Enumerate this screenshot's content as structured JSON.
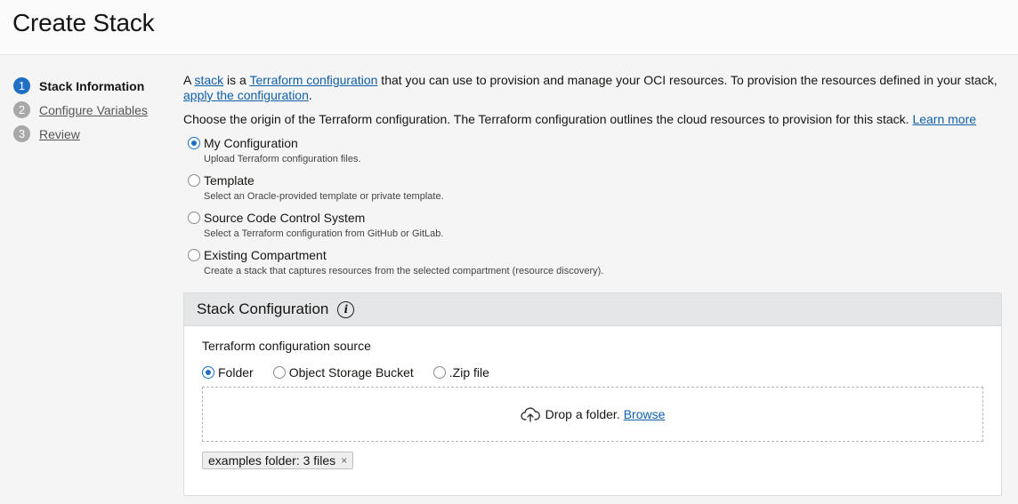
{
  "page": {
    "title": "Create Stack"
  },
  "steps": [
    {
      "num": "1",
      "label": "Stack Information"
    },
    {
      "num": "2",
      "label": "Configure Variables"
    },
    {
      "num": "3",
      "label": "Review"
    }
  ],
  "intro": {
    "a": "A ",
    "stack_link": "stack",
    "is_a": " is a ",
    "terraform_link": "Terraform configuration",
    "rest": " that you can use to provision and manage your OCI resources. To provision the resources defined in your stack, ",
    "apply_link": "apply the configuration",
    "end": "."
  },
  "choose": {
    "text": "Choose the origin of the Terraform configuration. The Terraform configuration outlines the cloud resources to provision for this stack. ",
    "learn_more": "Learn more"
  },
  "origins": [
    {
      "label": "My Configuration",
      "desc": "Upload Terraform configuration files.",
      "checked": true
    },
    {
      "label": "Template",
      "desc": "Select an Oracle-provided template or private template.",
      "checked": false
    },
    {
      "label": "Source Code Control System",
      "desc": "Select a Terraform configuration from GitHub or GitLab.",
      "checked": false
    },
    {
      "label": "Existing Compartment",
      "desc": "Create a stack that captures resources from the selected compartment (resource discovery).",
      "checked": false
    }
  ],
  "panel": {
    "title": "Stack Configuration",
    "info_icon": "i",
    "source_label": "Terraform configuration source",
    "source_options": [
      {
        "label": "Folder",
        "checked": true
      },
      {
        "label": "Object Storage Bucket",
        "checked": false
      },
      {
        "label": ".Zip file",
        "checked": false
      }
    ],
    "drop_text": "Drop a folder.",
    "browse": "Browse",
    "chip": "examples folder: 3 files",
    "chip_remove": "×"
  },
  "colors": {
    "accent": "#1f6fc5",
    "link": "#0f5fa8",
    "panel_header": "#e4e6e8"
  },
  "icons": {
    "upload": "cloud-upload-icon",
    "info": "info-icon",
    "remove": "close-icon"
  }
}
